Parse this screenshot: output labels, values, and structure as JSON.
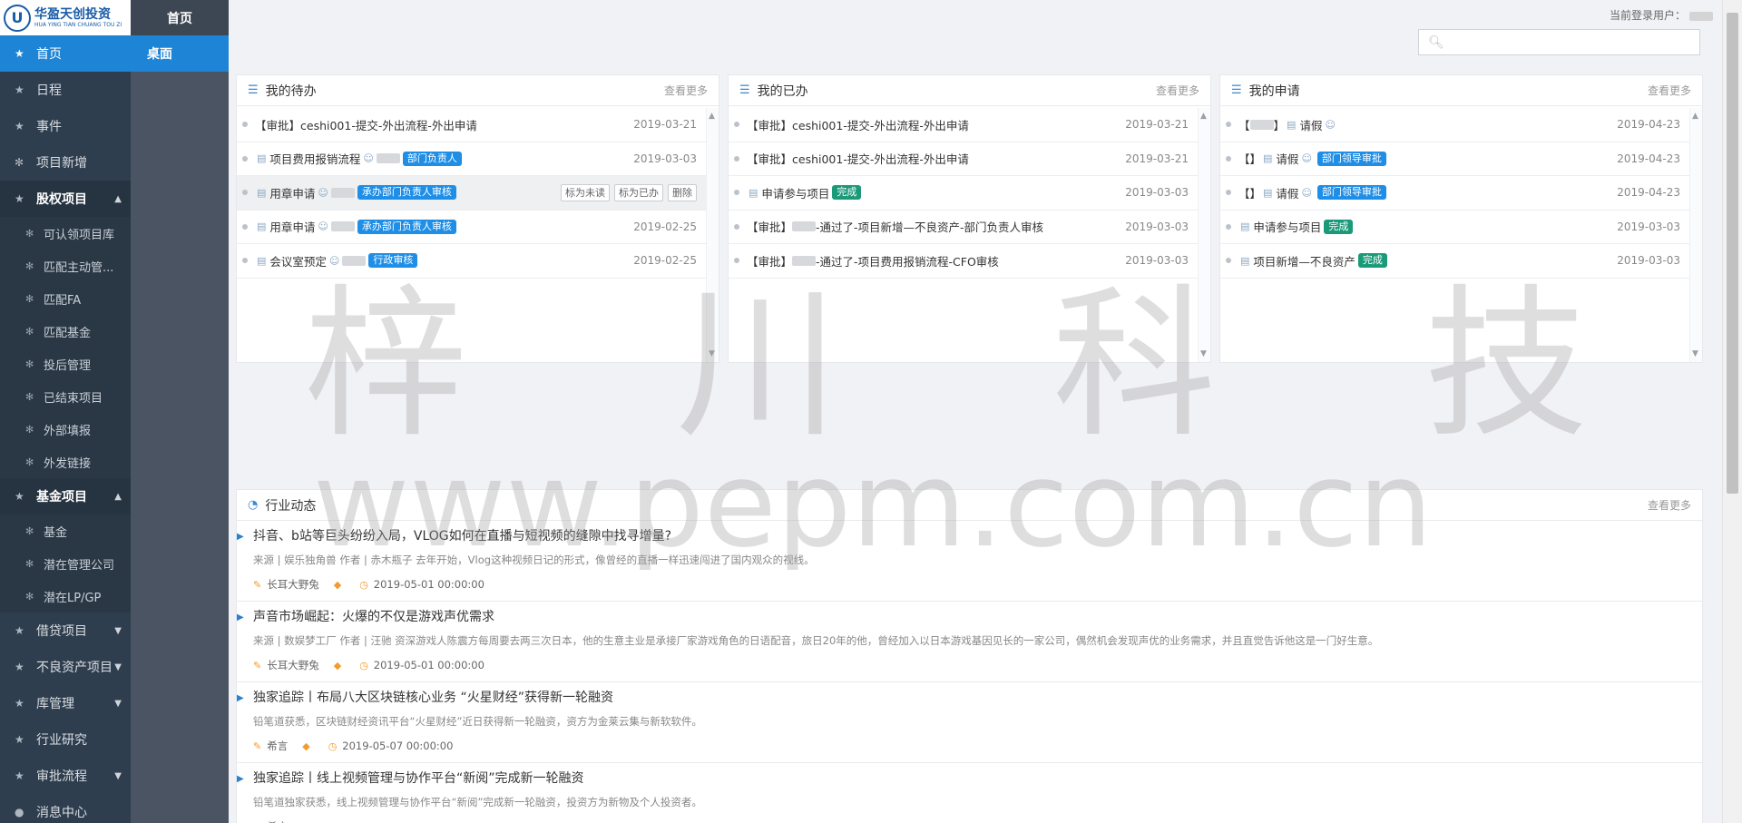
{
  "logo": {
    "cn": "华盈天创投资",
    "en": "HUA YING TIAN CHUANG TOU ZI",
    "mark": "U"
  },
  "nav": {
    "home": "首页",
    "items": [
      {
        "label": "日程"
      },
      {
        "label": "事件"
      },
      {
        "label": "项目新增"
      }
    ],
    "equity": {
      "label": "股权项目",
      "subs": [
        "可认领项目库",
        "匹配主动管...",
        "匹配FA",
        "匹配基金",
        "投后管理",
        "已结束项目",
        "外部填报",
        "外发链接"
      ]
    },
    "fund": {
      "label": "基金项目",
      "subs": [
        "基金",
        "潜在管理公司",
        "潜在LP/GP"
      ]
    },
    "more": [
      "借贷项目",
      "不良资产项目",
      "库管理",
      "行业研究",
      "审批流程",
      "消息中心"
    ]
  },
  "col2": {
    "header": "首页",
    "item": "桌面"
  },
  "topbar": {
    "user_label": "当前登录用户：",
    "search_placeholder": ""
  },
  "todo": {
    "title": "我的待办",
    "more": "查看更多",
    "rows": [
      {
        "text": "【审批】ceshi001-提交-外出流程-外出申请",
        "date": "2019-03-21"
      },
      {
        "text": "项目费用报销流程",
        "badge": "部门负责人",
        "date": "2019-03-03"
      },
      {
        "text": "用章申请",
        "badge": "承办部门负责人审核",
        "date": ""
      },
      {
        "text": "用章申请",
        "badge": "承办部门负责人审核",
        "date": "2019-02-25"
      },
      {
        "text": "会议室预定",
        "badge": "行政审核",
        "date": "2019-02-25"
      }
    ],
    "actions": [
      "标为未读",
      "标为已办",
      "删除"
    ]
  },
  "done": {
    "title": "我的已办",
    "more": "查看更多",
    "rows": [
      {
        "text": "【审批】ceshi001-提交-外出流程-外出申请",
        "date": "2019-03-21"
      },
      {
        "text": "【审批】ceshi001-提交-外出流程-外出申请",
        "date": "2019-03-21"
      },
      {
        "text": "申请参与项目",
        "badge": "完成",
        "date": "2019-03-03"
      },
      {
        "text_a": "【审批】",
        "text_b": "-通过了-项目新增—不良资产-部门负责人审核",
        "date": "2019-03-03"
      },
      {
        "text_a": "【审批】",
        "text_b": "-通过了-项目费用报销流程-CFO审核",
        "date": "2019-03-03"
      }
    ]
  },
  "apply": {
    "title": "我的申请",
    "more": "查看更多",
    "rows": [
      {
        "text_a": "【",
        "text_b": "】",
        "text": "请假",
        "date": "2019-04-23"
      },
      {
        "text_a": "【】",
        "text": "请假",
        "badge": "部门领导审批",
        "date": "2019-04-23"
      },
      {
        "text_a": "【】",
        "text": "请假",
        "badge": "部门领导审批",
        "date": "2019-04-23"
      },
      {
        "text": "申请参与项目",
        "badge": "完成",
        "date": "2019-03-03"
      },
      {
        "text": "项目新增—不良资产",
        "badge": "完成",
        "date": "2019-03-03"
      }
    ]
  },
  "news": {
    "title": "行业动态",
    "more": "查看更多",
    "items": [
      {
        "title": "抖音、b站等巨头纷纷入局，VLOG如何在直播与短视频的缝隙中找寻增量?",
        "desc": "来源 | 娱乐独角兽 作者 | 赤木瓶子 去年开始，Vlog这种视频日记的形式，像曾经的直播一样迅速闯进了国内观众的视线。",
        "author": "长耳大野兔",
        "time": "2019-05-01 00:00:00"
      },
      {
        "title": "声音市场崛起：火爆的不仅是游戏声优需求",
        "desc": "来源 | 数娱梦工厂 作者 | 汪驰 资深游戏人陈震方每周要去两三次日本，他的生意主业是承接厂家游戏角色的日语配音，旅日20年的他，曾经加入以日本游戏基因见长的一家公司，偶然机会发现声优的业务需求，并且直觉告诉他这是一门好生意。",
        "author": "长耳大野兔",
        "time": "2019-05-01 00:00:00"
      },
      {
        "title": "独家追踪丨布局八大区块链核心业务 “火星财经”获得新一轮融资",
        "desc": "铅笔道获悉，区块链财经资讯平台“火星财经”近日获得新一轮融资，资方为金莱云集与新软软件。",
        "author": "希言",
        "time": "2019-05-07 00:00:00"
      },
      {
        "title": "独家追踪丨线上视频管理与协作平台“新阅”完成新一轮融资",
        "desc": "铅笔道独家获悉，线上视频管理与协作平台“新阅”完成新一轮融资，投资方为新物及个人投资者。",
        "author": "希言",
        "time": ""
      }
    ]
  },
  "watermark": {
    "chars": [
      "梓",
      "川",
      "科",
      "技"
    ],
    "url": "www.pepm.com.cn"
  },
  "colors": {
    "accent": "#1e84d5",
    "nav_bg": "#2f3e4e",
    "badge_blue": "#1e8ee6",
    "badge_green": "#1a9a79"
  }
}
